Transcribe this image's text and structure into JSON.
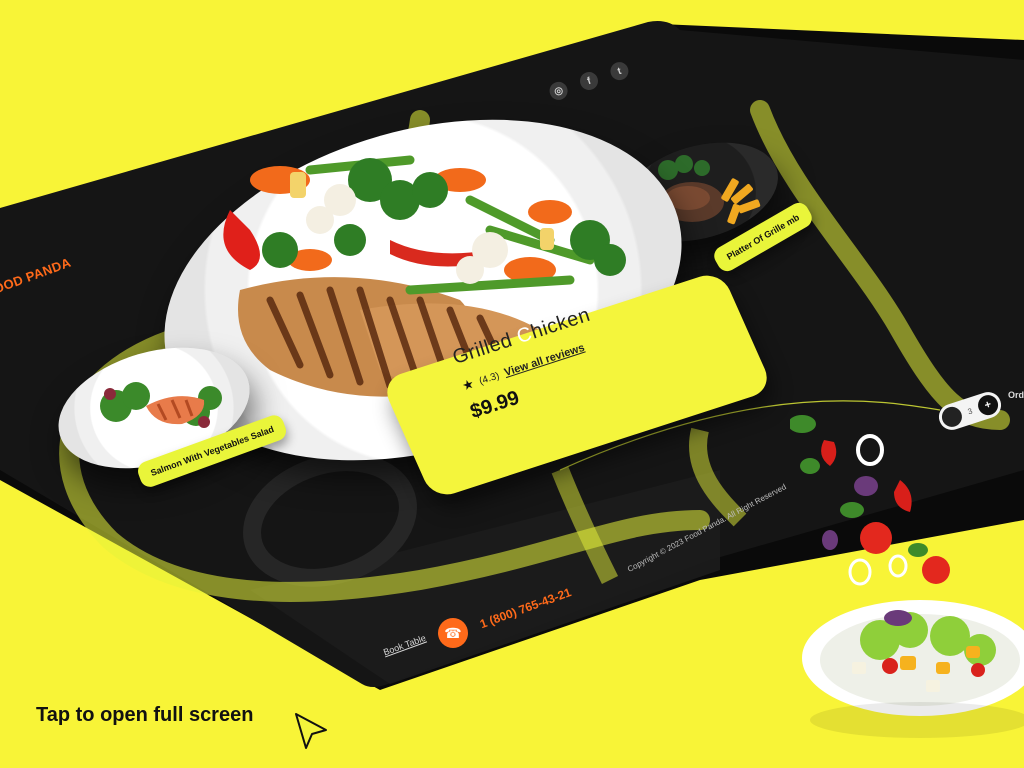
{
  "brand": {
    "name": "OOD PANDA",
    "color": "#ff6a1a"
  },
  "social": [
    {
      "icon": "instagram-icon",
      "glyph": "◎"
    },
    {
      "icon": "facebook-icon",
      "glyph": "f"
    },
    {
      "icon": "twitter-icon",
      "glyph": "t"
    }
  ],
  "tags": {
    "left": "Salmon With Vegetables Salad",
    "right": "Platter Of Grille     mb"
  },
  "card": {
    "title_a": "Grilled ",
    "title_o": "C",
    "title_b": "hicken",
    "rating": "(4.3)",
    "reviews_link": "View all reviews",
    "price": "$9.99"
  },
  "stepper": {
    "quantity": "3",
    "plus": "+"
  },
  "order_label": "Ord",
  "footer": {
    "copyright": "Copyright © 2023 Food Panda. All Right Reserved",
    "book_table": "Book Table",
    "phone": "1 (800) 765-43-21",
    "phone_icon": "☎"
  },
  "cta": {
    "text": "Tap to open full screen"
  },
  "colors": {
    "background": "#f8f437",
    "board": "#141414",
    "accent_yellow": "#f4f53c",
    "accent_orange": "#ff6a1a"
  }
}
